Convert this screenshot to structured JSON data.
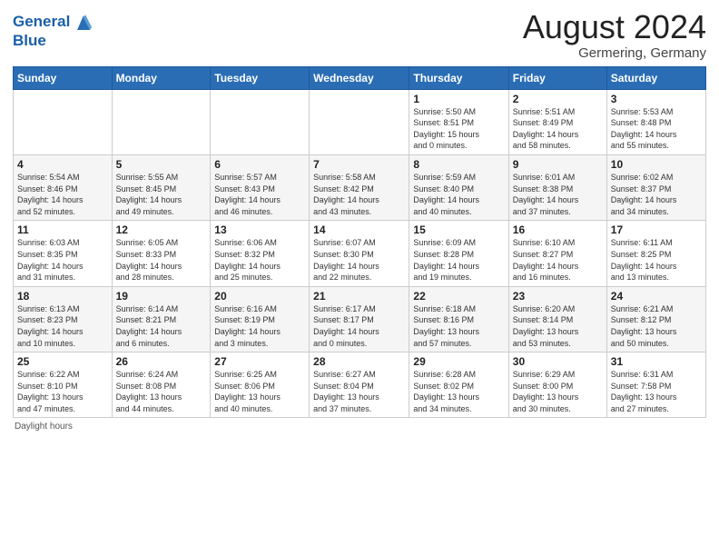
{
  "header": {
    "logo_line1": "General",
    "logo_line2": "Blue",
    "month_year": "August 2024",
    "location": "Germering, Germany"
  },
  "days_of_week": [
    "Sunday",
    "Monday",
    "Tuesday",
    "Wednesday",
    "Thursday",
    "Friday",
    "Saturday"
  ],
  "weeks": [
    [
      {
        "num": "",
        "info": ""
      },
      {
        "num": "",
        "info": ""
      },
      {
        "num": "",
        "info": ""
      },
      {
        "num": "",
        "info": ""
      },
      {
        "num": "1",
        "info": "Sunrise: 5:50 AM\nSunset: 8:51 PM\nDaylight: 15 hours\nand 0 minutes."
      },
      {
        "num": "2",
        "info": "Sunrise: 5:51 AM\nSunset: 8:49 PM\nDaylight: 14 hours\nand 58 minutes."
      },
      {
        "num": "3",
        "info": "Sunrise: 5:53 AM\nSunset: 8:48 PM\nDaylight: 14 hours\nand 55 minutes."
      }
    ],
    [
      {
        "num": "4",
        "info": "Sunrise: 5:54 AM\nSunset: 8:46 PM\nDaylight: 14 hours\nand 52 minutes."
      },
      {
        "num": "5",
        "info": "Sunrise: 5:55 AM\nSunset: 8:45 PM\nDaylight: 14 hours\nand 49 minutes."
      },
      {
        "num": "6",
        "info": "Sunrise: 5:57 AM\nSunset: 8:43 PM\nDaylight: 14 hours\nand 46 minutes."
      },
      {
        "num": "7",
        "info": "Sunrise: 5:58 AM\nSunset: 8:42 PM\nDaylight: 14 hours\nand 43 minutes."
      },
      {
        "num": "8",
        "info": "Sunrise: 5:59 AM\nSunset: 8:40 PM\nDaylight: 14 hours\nand 40 minutes."
      },
      {
        "num": "9",
        "info": "Sunrise: 6:01 AM\nSunset: 8:38 PM\nDaylight: 14 hours\nand 37 minutes."
      },
      {
        "num": "10",
        "info": "Sunrise: 6:02 AM\nSunset: 8:37 PM\nDaylight: 14 hours\nand 34 minutes."
      }
    ],
    [
      {
        "num": "11",
        "info": "Sunrise: 6:03 AM\nSunset: 8:35 PM\nDaylight: 14 hours\nand 31 minutes."
      },
      {
        "num": "12",
        "info": "Sunrise: 6:05 AM\nSunset: 8:33 PM\nDaylight: 14 hours\nand 28 minutes."
      },
      {
        "num": "13",
        "info": "Sunrise: 6:06 AM\nSunset: 8:32 PM\nDaylight: 14 hours\nand 25 minutes."
      },
      {
        "num": "14",
        "info": "Sunrise: 6:07 AM\nSunset: 8:30 PM\nDaylight: 14 hours\nand 22 minutes."
      },
      {
        "num": "15",
        "info": "Sunrise: 6:09 AM\nSunset: 8:28 PM\nDaylight: 14 hours\nand 19 minutes."
      },
      {
        "num": "16",
        "info": "Sunrise: 6:10 AM\nSunset: 8:27 PM\nDaylight: 14 hours\nand 16 minutes."
      },
      {
        "num": "17",
        "info": "Sunrise: 6:11 AM\nSunset: 8:25 PM\nDaylight: 14 hours\nand 13 minutes."
      }
    ],
    [
      {
        "num": "18",
        "info": "Sunrise: 6:13 AM\nSunset: 8:23 PM\nDaylight: 14 hours\nand 10 minutes."
      },
      {
        "num": "19",
        "info": "Sunrise: 6:14 AM\nSunset: 8:21 PM\nDaylight: 14 hours\nand 6 minutes."
      },
      {
        "num": "20",
        "info": "Sunrise: 6:16 AM\nSunset: 8:19 PM\nDaylight: 14 hours\nand 3 minutes."
      },
      {
        "num": "21",
        "info": "Sunrise: 6:17 AM\nSunset: 8:17 PM\nDaylight: 14 hours\nand 0 minutes."
      },
      {
        "num": "22",
        "info": "Sunrise: 6:18 AM\nSunset: 8:16 PM\nDaylight: 13 hours\nand 57 minutes."
      },
      {
        "num": "23",
        "info": "Sunrise: 6:20 AM\nSunset: 8:14 PM\nDaylight: 13 hours\nand 53 minutes."
      },
      {
        "num": "24",
        "info": "Sunrise: 6:21 AM\nSunset: 8:12 PM\nDaylight: 13 hours\nand 50 minutes."
      }
    ],
    [
      {
        "num": "25",
        "info": "Sunrise: 6:22 AM\nSunset: 8:10 PM\nDaylight: 13 hours\nand 47 minutes."
      },
      {
        "num": "26",
        "info": "Sunrise: 6:24 AM\nSunset: 8:08 PM\nDaylight: 13 hours\nand 44 minutes."
      },
      {
        "num": "27",
        "info": "Sunrise: 6:25 AM\nSunset: 8:06 PM\nDaylight: 13 hours\nand 40 minutes."
      },
      {
        "num": "28",
        "info": "Sunrise: 6:27 AM\nSunset: 8:04 PM\nDaylight: 13 hours\nand 37 minutes."
      },
      {
        "num": "29",
        "info": "Sunrise: 6:28 AM\nSunset: 8:02 PM\nDaylight: 13 hours\nand 34 minutes."
      },
      {
        "num": "30",
        "info": "Sunrise: 6:29 AM\nSunset: 8:00 PM\nDaylight: 13 hours\nand 30 minutes."
      },
      {
        "num": "31",
        "info": "Sunrise: 6:31 AM\nSunset: 7:58 PM\nDaylight: 13 hours\nand 27 minutes."
      }
    ]
  ],
  "footer": {
    "note": "Daylight hours"
  }
}
